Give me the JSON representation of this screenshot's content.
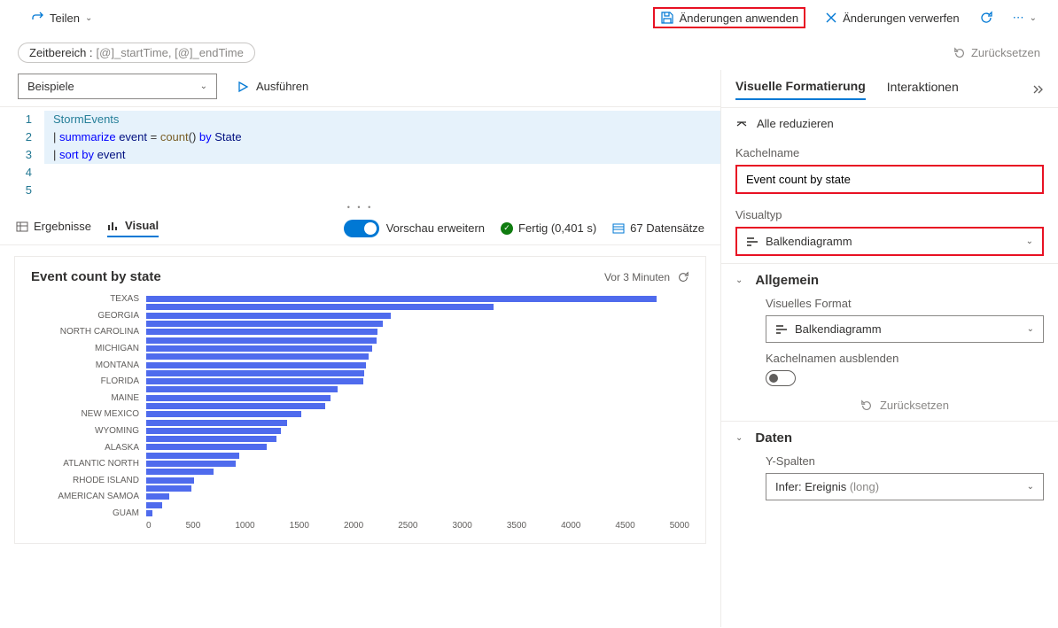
{
  "toolbar": {
    "share": "Teilen",
    "apply": "Änderungen anwenden",
    "discard": "Änderungen verwerfen"
  },
  "timerange": {
    "label": "Zeitbereich :",
    "value": "[@]_startTime, [@]_endTime"
  },
  "reset_top": "Zurücksetzen",
  "examples": {
    "label": "Beispiele",
    "run": "Ausführen"
  },
  "editor": {
    "lines": [
      "1",
      "2",
      "3",
      "4",
      "5"
    ],
    "l1_a": "StormEvents",
    "l2_pipe": "| ",
    "l2_kw": "summarize",
    "l2_ident": " event ",
    "l2_eq": "=",
    "l2_fn": " count",
    "l2_paren": "() ",
    "l2_by": "by",
    "l2_state": " State",
    "l3_pipe": "| ",
    "l3_kw": "sort by",
    "l3_ident": " event"
  },
  "results_row": {
    "results": "Ergebnisse",
    "visual": "Visual",
    "preview": "Vorschau erweitern",
    "done": "Fertig (0,401 s)",
    "records": "67 Datensätze"
  },
  "chart": {
    "title": "Event count by state",
    "time": "Vor 3 Minuten"
  },
  "chart_data": {
    "type": "bar",
    "orientation": "horizontal",
    "title": "Event count by state",
    "xlabel": "",
    "ylabel": "",
    "xlim": [
      0,
      5000
    ],
    "xticks": [
      0,
      500,
      1000,
      1500,
      2000,
      2500,
      3000,
      3500,
      4000,
      4500,
      5000
    ],
    "categories_shown": [
      "TEXAS",
      "",
      "GEORGIA",
      "",
      "NORTH CAROLINA",
      "",
      "MICHIGAN",
      "",
      "MONTANA",
      "",
      "FLORIDA",
      "",
      "MAINE",
      "",
      "NEW MEXICO",
      "",
      "WYOMING",
      "",
      "ALASKA",
      "",
      "ATLANTIC NORTH",
      "",
      "RHODE ISLAND",
      "",
      "AMERICAN SAMOA",
      "",
      "GUAM"
    ],
    "values": [
      4700,
      3200,
      2250,
      2180,
      2130,
      2120,
      2080,
      2050,
      2020,
      2010,
      2000,
      1760,
      1700,
      1650,
      1430,
      1300,
      1240,
      1200,
      1110,
      860,
      820,
      620,
      440,
      420,
      210,
      150,
      60
    ]
  },
  "panel": {
    "tab_visual": "Visuelle Formatierung",
    "tab_inter": "Interaktionen",
    "collapse_all": "Alle reduzieren",
    "tile_label": "Kachelname",
    "tile_value": "Event count by state",
    "visualtype_label": "Visualtyp",
    "visualtype_value": "Balkendiagramm",
    "general": "Allgemein",
    "visformat_label": "Visuelles Format",
    "visformat_value": "Balkendiagramm",
    "hidename_label": "Kachelnamen ausblenden",
    "reset": "Zurücksetzen",
    "daten": "Daten",
    "ycol_label": "Y-Spalten",
    "ycol_value": "Infer: Ereignis",
    "ycol_type": " (long)"
  }
}
